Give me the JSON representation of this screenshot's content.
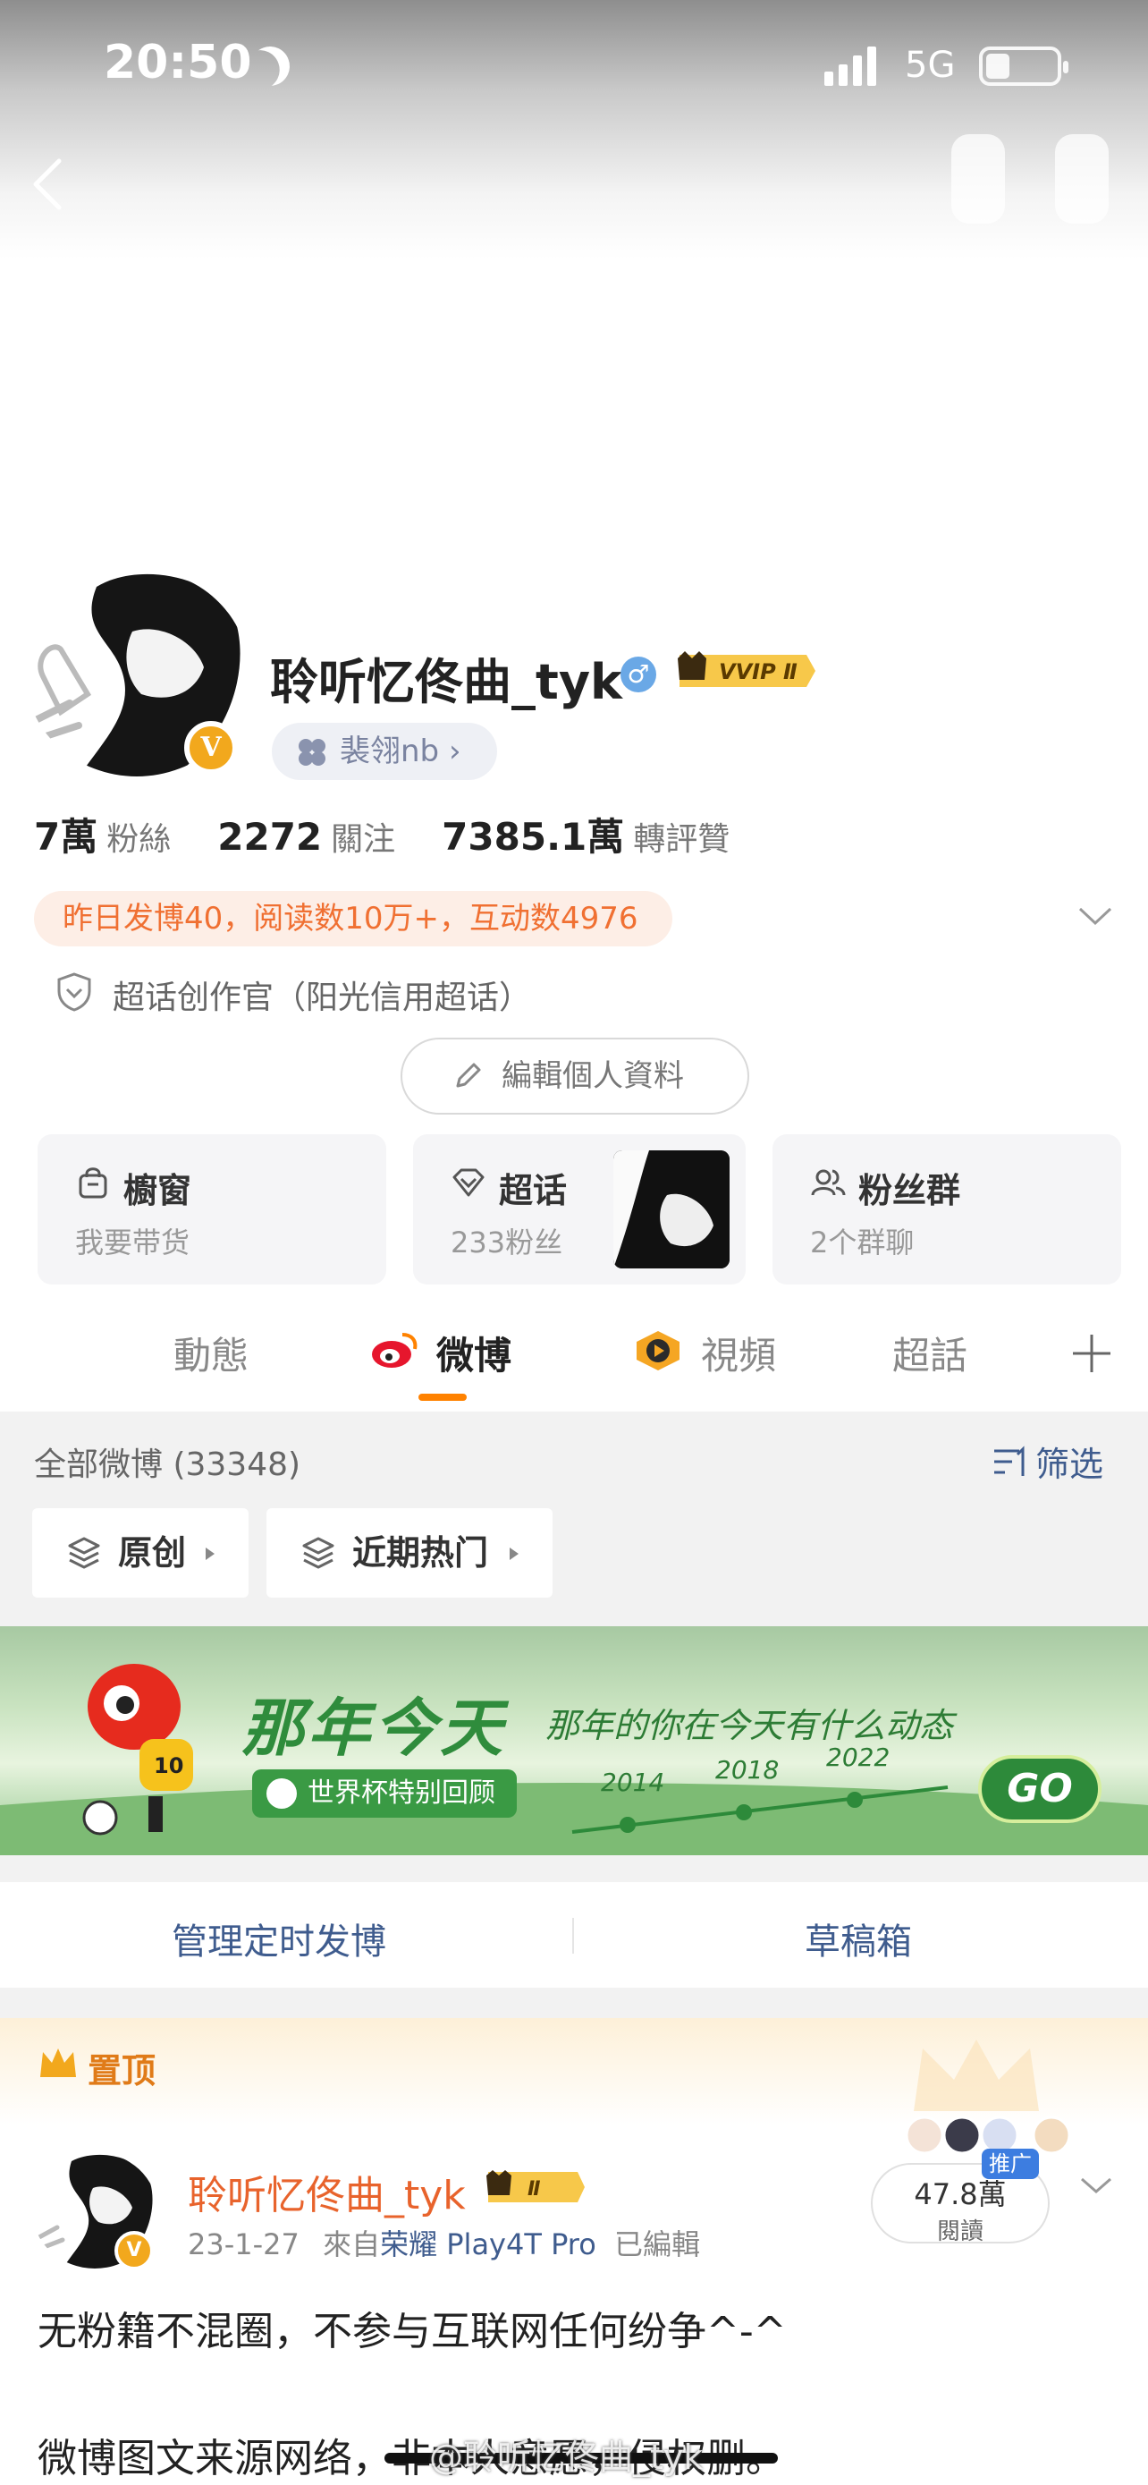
{
  "status_bar": {
    "time": "20:50",
    "network": "5G"
  },
  "profile": {
    "name": "聆听忆佟曲_tyk",
    "tag": "裴翎nb ›",
    "verified_mark": "V",
    "vip_badge": "VVIP Ⅱ",
    "stats": [
      {
        "value": "7萬",
        "label": "粉絲"
      },
      {
        "value": "2272",
        "label": "關注"
      },
      {
        "value": "7385.1萬",
        "label": "轉評贊"
      }
    ],
    "activity_summary": "昨日发博40，阅读数10万+，互动数4976",
    "title_line": "超话创作官（阳光信用超话）",
    "edit_button": "編輯個人資料"
  },
  "cards": [
    {
      "title": "櫥窗",
      "subtitle": "我要带货",
      "icon": "bag-icon"
    },
    {
      "title": "超话",
      "subtitle": "233粉丝",
      "icon": "diamond-icon"
    },
    {
      "title": "粉丝群",
      "subtitle": "2个群聊",
      "icon": "group-icon"
    }
  ],
  "tabs": [
    "動態",
    "微博",
    "視頻",
    "超話"
  ],
  "active_tab": "微博",
  "feed": {
    "count_label": "全部微博 (33348)",
    "filter_label": "筛选",
    "chips": [
      "原创",
      "近期热门"
    ]
  },
  "banner": {
    "title": "那年今天",
    "subtitle": "那年的你在今天有什么动态",
    "pill": "世界杯特别回顾",
    "years": [
      "2014",
      "2018",
      "2022"
    ],
    "go": "GO",
    "mascot_number": "10"
  },
  "actions": [
    "管理定时发博",
    "草稿箱"
  ],
  "pinned_post": {
    "pin_label": "置顶",
    "author": "聆听忆佟曲_tyk",
    "vip_badge": "Ⅱ",
    "date": "23-1-27",
    "source_prefix": "來自",
    "device": "荣耀 Play4T Pro",
    "edited": "已編輯",
    "reads_value": "47.8萬",
    "reads_label": "閱讀",
    "promo": "推广",
    "text_line1": "无粉籍不混圈，不参与互联网任何纷争^-^",
    "text_line2": "微博图文来源网络，非本人意愿，侵权删。",
    "watermark": "@聆听忆佟曲_tyk"
  },
  "colors": {
    "accent": "#ff8200",
    "link_blue": "#3f5c8e",
    "orange_text": "#f07032"
  }
}
